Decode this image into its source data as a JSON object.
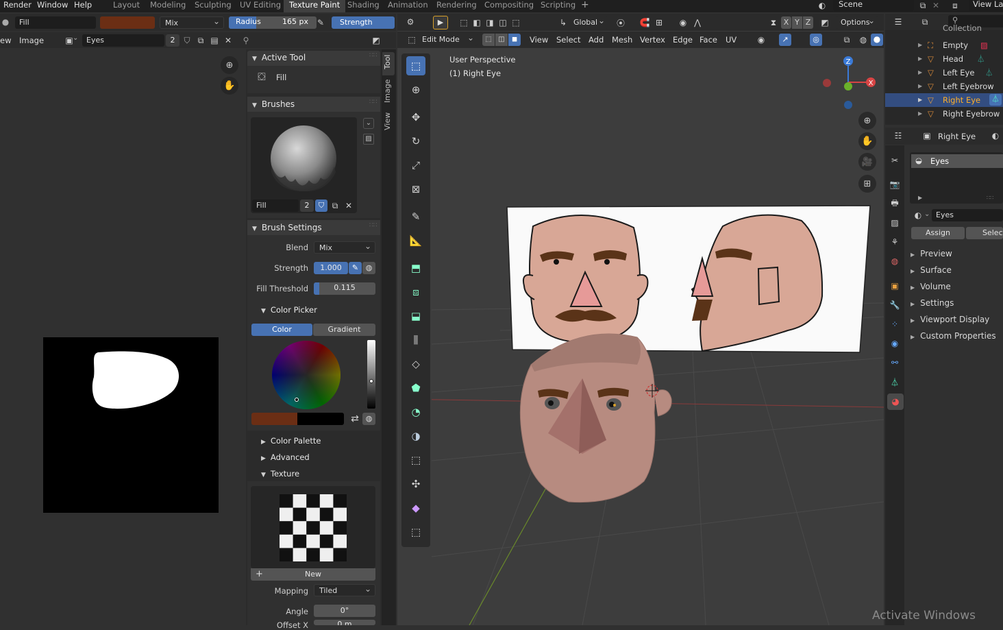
{
  "menu": {
    "render": "Render",
    "window": "Window",
    "help": "Help"
  },
  "workspace_tabs": [
    "Layout",
    "Modeling",
    "Sculpting",
    "UV Editing",
    "Texture Paint",
    "Shading",
    "Animation",
    "Rendering",
    "Compositing",
    "Scripting"
  ],
  "active_tab": "Texture Paint",
  "scene": {
    "label": "Scene",
    "view_layer": "View Lay"
  },
  "tool_header": {
    "brush_name": "Fill",
    "blend": "Mix",
    "radius_label": "Radius",
    "radius_value": "165 px",
    "strength_label": "Strength",
    "color": "#6b2e14"
  },
  "image_editor": {
    "view_menu": "ew",
    "image_menu": "Image",
    "image_name": "Eyes",
    "users": "2"
  },
  "sidebar_tabs": [
    "Tool",
    "Image",
    "View"
  ],
  "active_tool": {
    "title": "Active Tool",
    "name": "Fill"
  },
  "brushes": {
    "title": "Brushes",
    "brush_name": "Fill",
    "users": "2"
  },
  "brush_settings": {
    "title": "Brush Settings",
    "blend_label": "Blend",
    "blend_value": "Mix",
    "strength_label": "Strength",
    "strength_value": "1.000",
    "fill_threshold_label": "Fill Threshold",
    "fill_threshold_value": "0.115",
    "color_picker_title": "Color Picker",
    "color_tab": "Color",
    "gradient_tab": "Gradient",
    "primary_color": "#6b2e14",
    "secondary_color": "#000000"
  },
  "collapsed": {
    "color_palette": "Color Palette",
    "advanced": "Advanced",
    "texture": "Texture"
  },
  "texture": {
    "new_label": "New",
    "mapping_label": "Mapping",
    "mapping_value": "Tiled",
    "angle_label": "Angle",
    "angle_value": "0°",
    "offset_label": "Offset X",
    "offset_value": "0 m"
  },
  "viewport": {
    "mode": "Edit Mode",
    "menus": [
      "View",
      "Select",
      "Add",
      "Mesh",
      "Vertex",
      "Edge",
      "Face",
      "UV"
    ],
    "orientation": "Global",
    "options": "Options",
    "perspective": "User Perspective",
    "object_label": "(1) Right Eye",
    "gizmo": {
      "x": "X",
      "y": "Y",
      "z": "Z"
    },
    "axis_buttons": [
      "X",
      "Y",
      "Z"
    ]
  },
  "outliner": {
    "partial_top": "Collection",
    "items": [
      "Empty",
      "Head",
      "Left Eye",
      "Left Eyebrow",
      "Right Eye",
      "Right Eyebrow"
    ],
    "selected": "Right Eye"
  },
  "properties": {
    "object_name": "Right Eye",
    "material_slot": "Eyes",
    "material_name": "Eyes",
    "assign": "Assign",
    "select": "Select",
    "sections": [
      "Preview",
      "Surface",
      "Volume",
      "Settings",
      "Viewport Display",
      "Custom Properties"
    ]
  },
  "watermark": "Activate Windows"
}
